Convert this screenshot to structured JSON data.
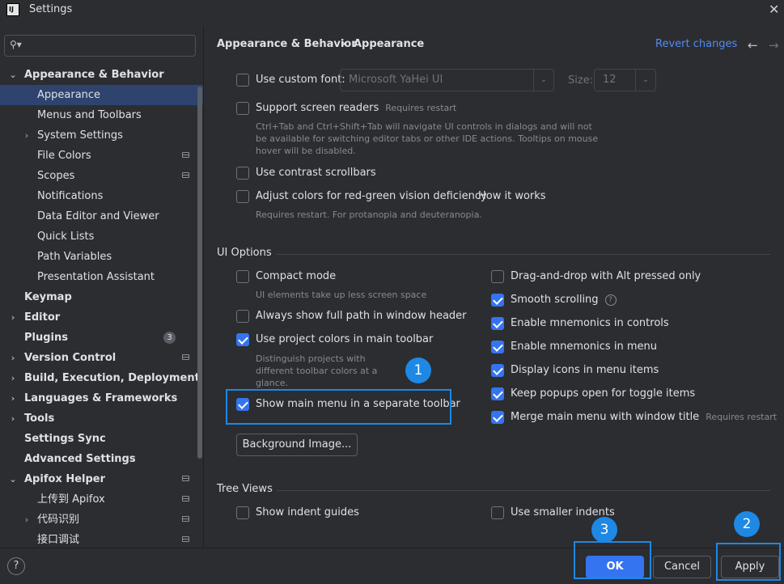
{
  "window": {
    "title": "Settings",
    "app_icon": "IJ"
  },
  "search": {
    "placeholder": ""
  },
  "sidebar": {
    "items": [
      {
        "label": "Appearance & Behavior"
      },
      {
        "label": "Appearance"
      },
      {
        "label": "Menus and Toolbars"
      },
      {
        "label": "System Settings"
      },
      {
        "label": "File Colors"
      },
      {
        "label": "Scopes"
      },
      {
        "label": "Notifications"
      },
      {
        "label": "Data Editor and Viewer"
      },
      {
        "label": "Quick Lists"
      },
      {
        "label": "Path Variables"
      },
      {
        "label": "Presentation Assistant"
      },
      {
        "label": "Keymap"
      },
      {
        "label": "Editor"
      },
      {
        "label": "Plugins",
        "badge": "3"
      },
      {
        "label": "Version Control"
      },
      {
        "label": "Build, Execution, Deployment"
      },
      {
        "label": "Languages & Frameworks"
      },
      {
        "label": "Tools"
      },
      {
        "label": "Settings Sync"
      },
      {
        "label": "Advanced Settings"
      },
      {
        "label": "Apifox Helper"
      },
      {
        "label": "上传到 Apifox"
      },
      {
        "label": "代码识别"
      },
      {
        "label": "接口调试"
      }
    ]
  },
  "header": {
    "crumb_parent": "Appearance & Behavior",
    "crumb_sep": "›",
    "crumb_current": "Appearance",
    "revert": "Revert changes",
    "back": "←",
    "forward": "→"
  },
  "options": {
    "custom_font": {
      "label": "Use custom font:",
      "font_value": "Microsoft YaHei UI",
      "size_label": "Size:",
      "size_value": "12",
      "checked": false
    },
    "screen_readers": {
      "label": "Support screen readers",
      "inline_hint": "Requires restart",
      "hint": "Ctrl+Tab and Ctrl+Shift+Tab will navigate UI controls in dialogs and will not be available for switching editor tabs or other IDE actions. Tooltips on mouse hover will be disabled.",
      "checked": false
    },
    "contrast_scrollbars": {
      "label": "Use contrast scrollbars",
      "checked": false
    },
    "color_deficiency": {
      "label": "Adjust colors for red-green vision deficiency",
      "link": "How it works",
      "hint": "Requires restart. For protanopia and deuteranopia.",
      "checked": false
    }
  },
  "ui_options": {
    "title": "UI Options",
    "left": [
      {
        "label": "Compact mode",
        "checked": false,
        "hint": "UI elements take up less screen space"
      },
      {
        "label": "Always show full path in window header",
        "checked": false
      },
      {
        "label": "Use project colors in main toolbar",
        "checked": true,
        "hint": "Distinguish projects with different toolbar colors at a glance."
      },
      {
        "label": "Show main menu in a separate toolbar",
        "checked": true
      }
    ],
    "right": [
      {
        "label": "Drag-and-drop with Alt pressed only",
        "checked": false
      },
      {
        "label": "Smooth scrolling",
        "checked": true,
        "help": "?"
      },
      {
        "label": "Enable mnemonics in controls",
        "checked": true
      },
      {
        "label": "Enable mnemonics in menu",
        "checked": true
      },
      {
        "label": "Display icons in menu items",
        "checked": true
      },
      {
        "label": "Keep popups open for toggle items",
        "checked": true
      },
      {
        "label": "Merge main menu with window title",
        "checked": true,
        "inline_hint": "Requires restart"
      }
    ],
    "background_button": "Background Image..."
  },
  "tree_views": {
    "title": "Tree Views",
    "indent_guides": {
      "label": "Show indent guides",
      "checked": false
    },
    "smaller_indents": {
      "label": "Use smaller indents",
      "checked": false
    }
  },
  "footer": {
    "help": "?",
    "ok": "OK",
    "cancel": "Cancel",
    "apply": "Apply"
  },
  "markers": {
    "m1": "1",
    "m2": "2",
    "m3": "3"
  },
  "colors": {
    "accent": "#3574f0",
    "highlight": "#1e88e5",
    "background": "#2b2d30",
    "selected": "#2e436e"
  }
}
